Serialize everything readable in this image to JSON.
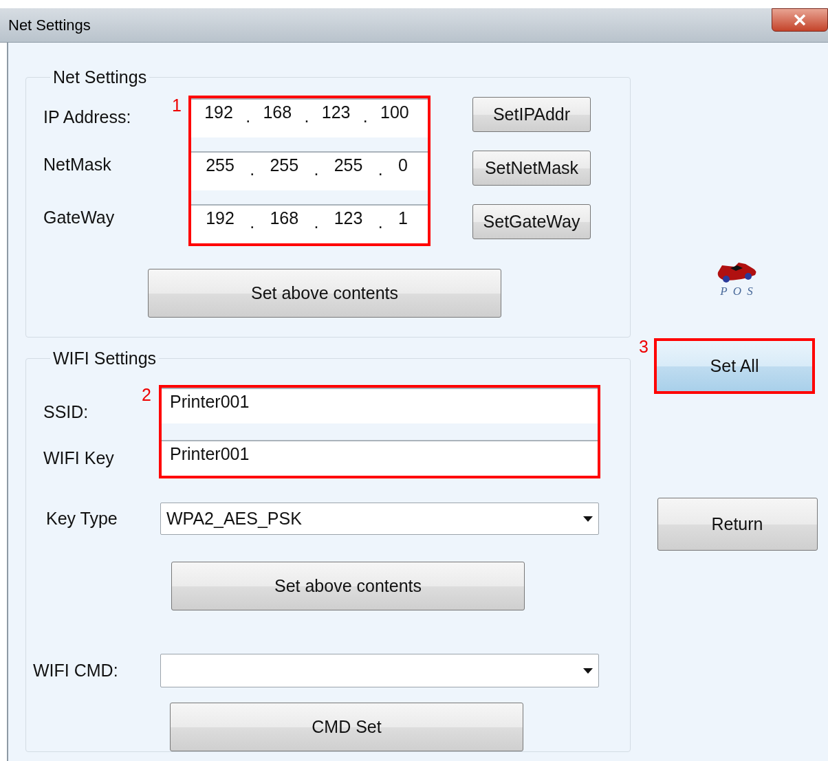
{
  "window": {
    "title": "Net Settings"
  },
  "net_settings": {
    "title": "Net Settings",
    "annotation": "1",
    "separator": ".",
    "rows": [
      {
        "label": "IP Address:",
        "octets": [
          "192",
          "168",
          "123",
          "100"
        ],
        "button": "SetIPAddr"
      },
      {
        "label": "NetMask",
        "octets": [
          "255",
          "255",
          "255",
          "0"
        ],
        "button": "SetNetMask"
      },
      {
        "label": "GateWay",
        "octets": [
          "192",
          "168",
          "123",
          "1"
        ],
        "button": "SetGateWay"
      }
    ],
    "apply_button": "Set above contents"
  },
  "wifi_settings": {
    "title": "WIFI Settings",
    "annotation": "2",
    "fields": [
      {
        "label": "SSID:",
        "value": "Printer001"
      },
      {
        "label": "WIFI Key",
        "value": "Printer001"
      }
    ],
    "key_type": {
      "label": "Key Type",
      "value": "WPA2_AES_PSK"
    },
    "apply_button": "Set above contents",
    "cmd": {
      "label": "WIFI CMD:"
    },
    "cmd_button": "CMD Set"
  },
  "logo": {
    "text": "P O S"
  },
  "set_all": {
    "label": "Set All",
    "annotation": "3"
  },
  "return_button": "Return"
}
